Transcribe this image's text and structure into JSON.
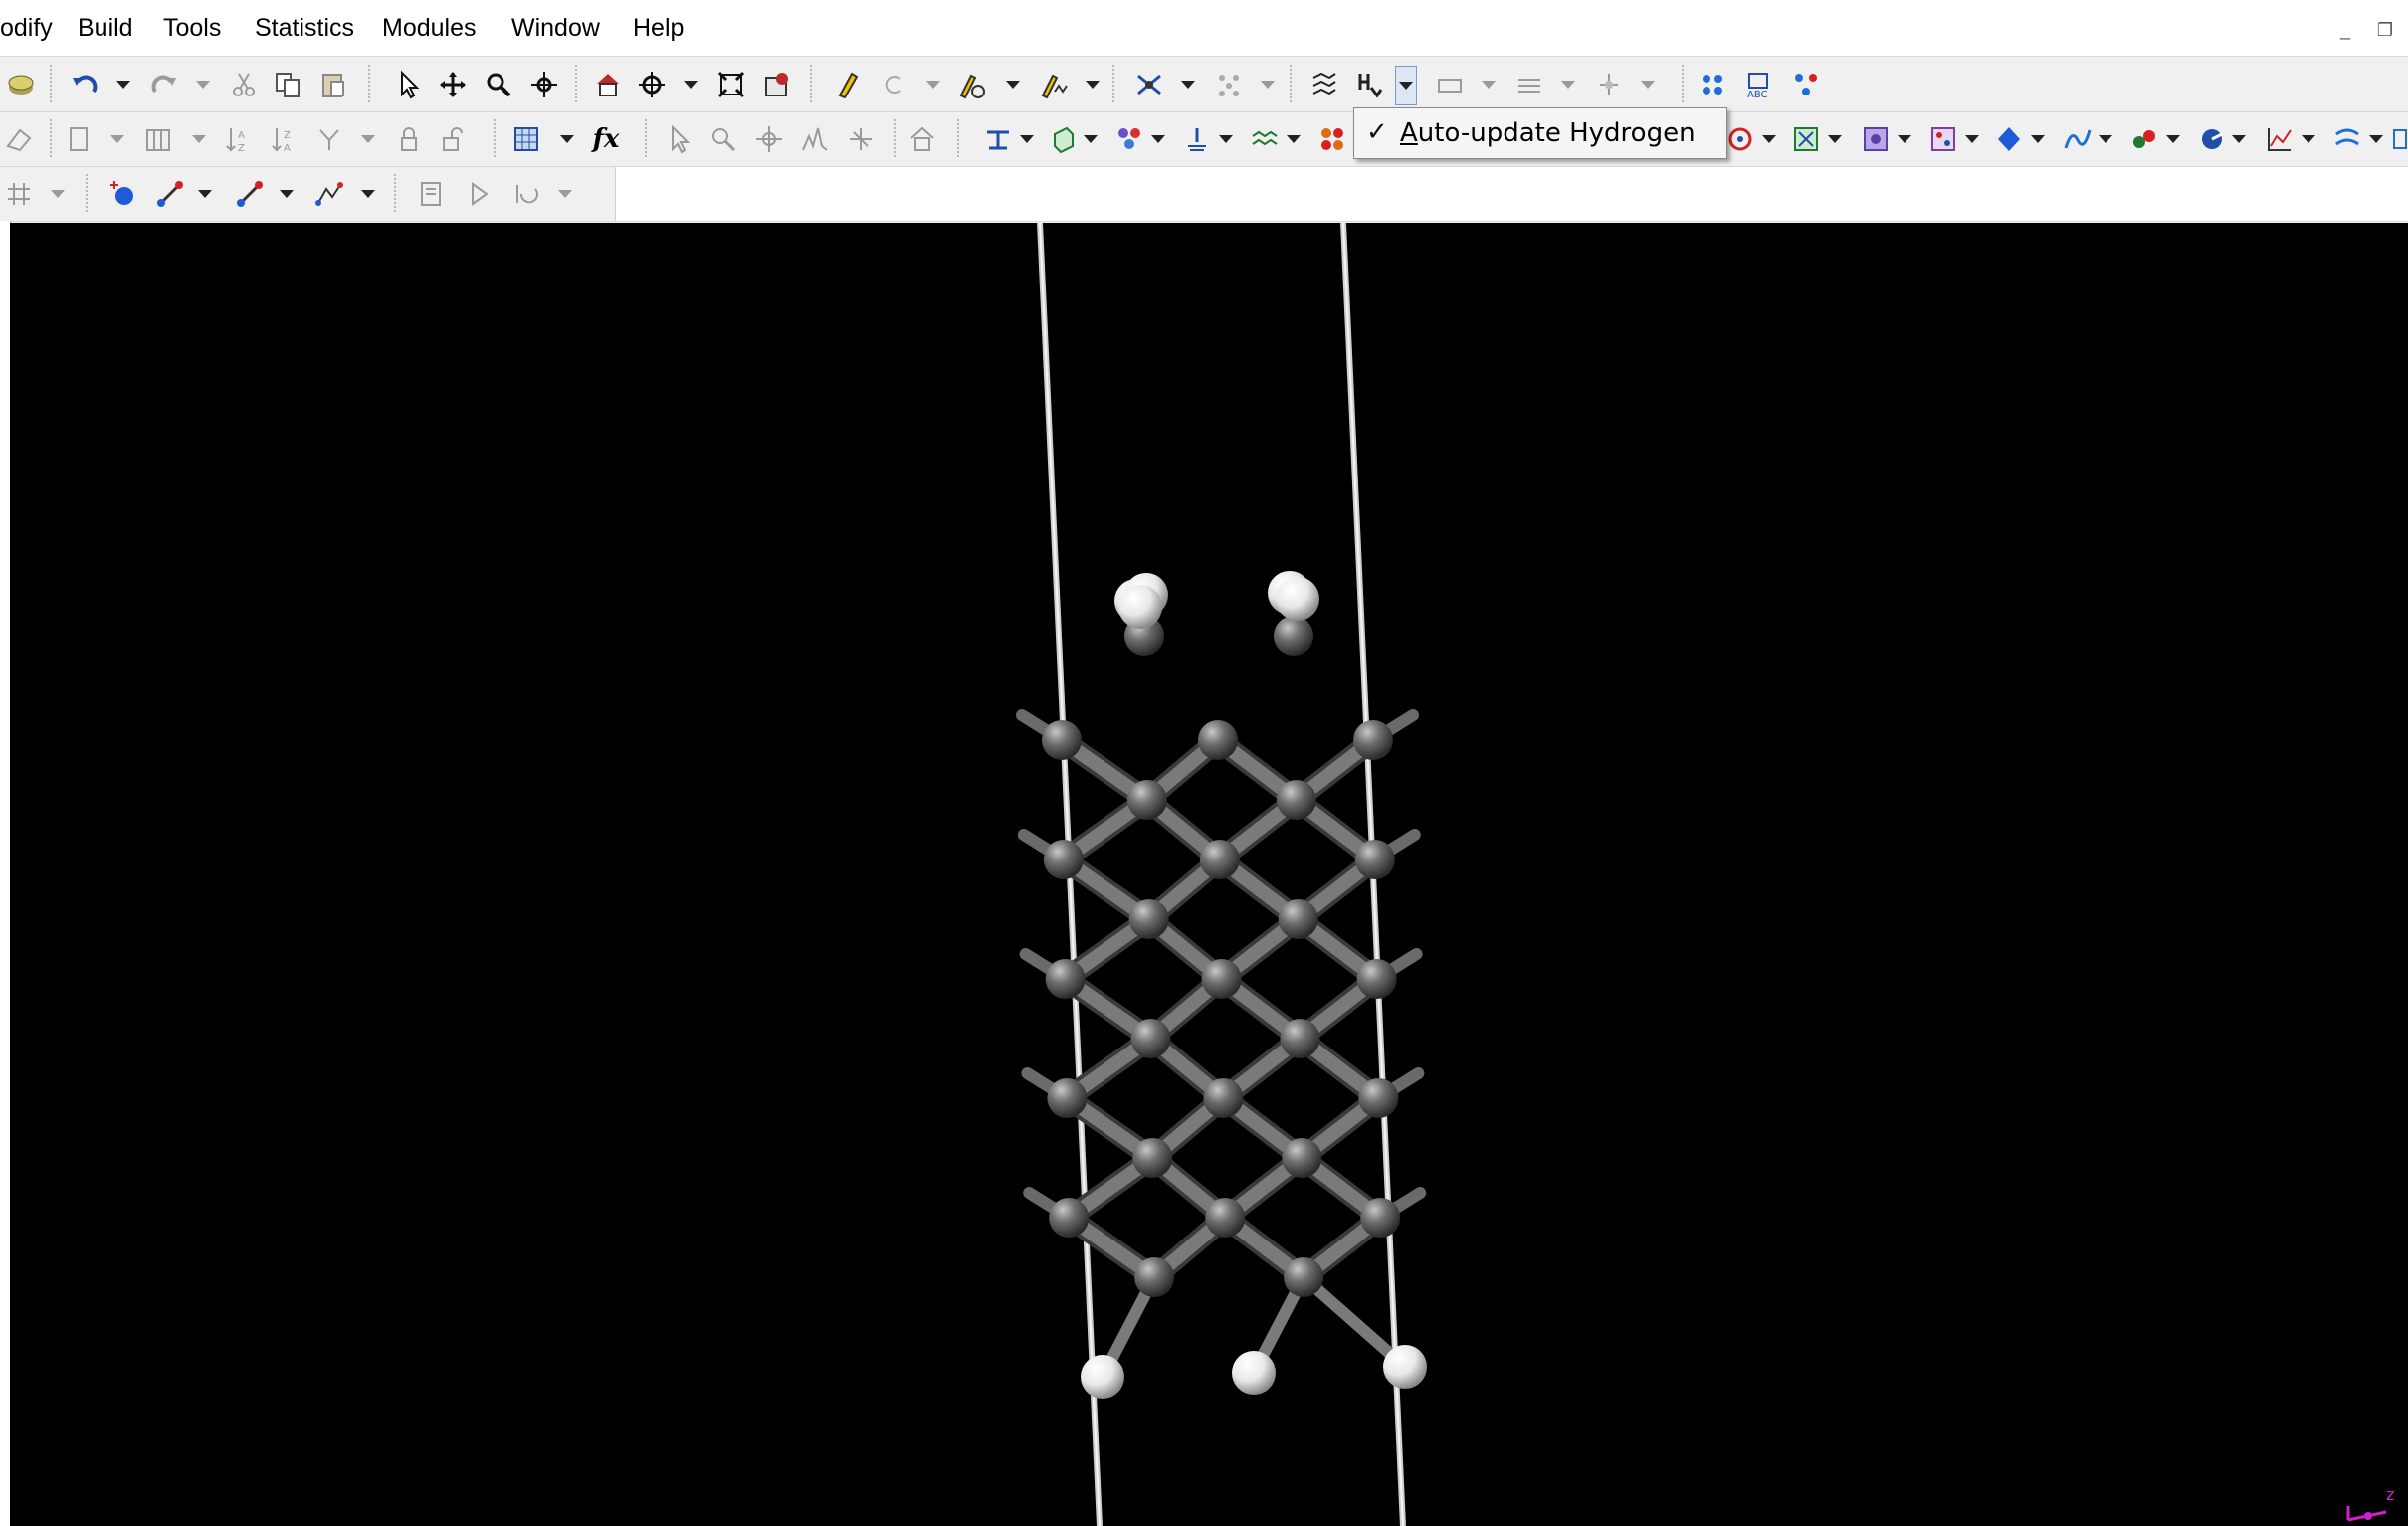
{
  "menubar": {
    "items": [
      "odify",
      "Build",
      "Tools",
      "Statistics",
      "Modules",
      "Window",
      "Help"
    ]
  },
  "window_controls": {
    "minimize": "_",
    "restore": "❐"
  },
  "toolbar": {
    "formula_label": "fx"
  },
  "dropdown": {
    "check": "✓",
    "mnemonic": "A",
    "label_rest": "uto-update Hydrogen",
    "checked": true
  },
  "viewport": {
    "background": "#000000",
    "atom_carbon_color": "#6e6e6e",
    "atom_hydrogen_color": "#f2f2f2",
    "cell_line_color": "#e6e6e6"
  },
  "axis": {
    "z_label": "z"
  }
}
